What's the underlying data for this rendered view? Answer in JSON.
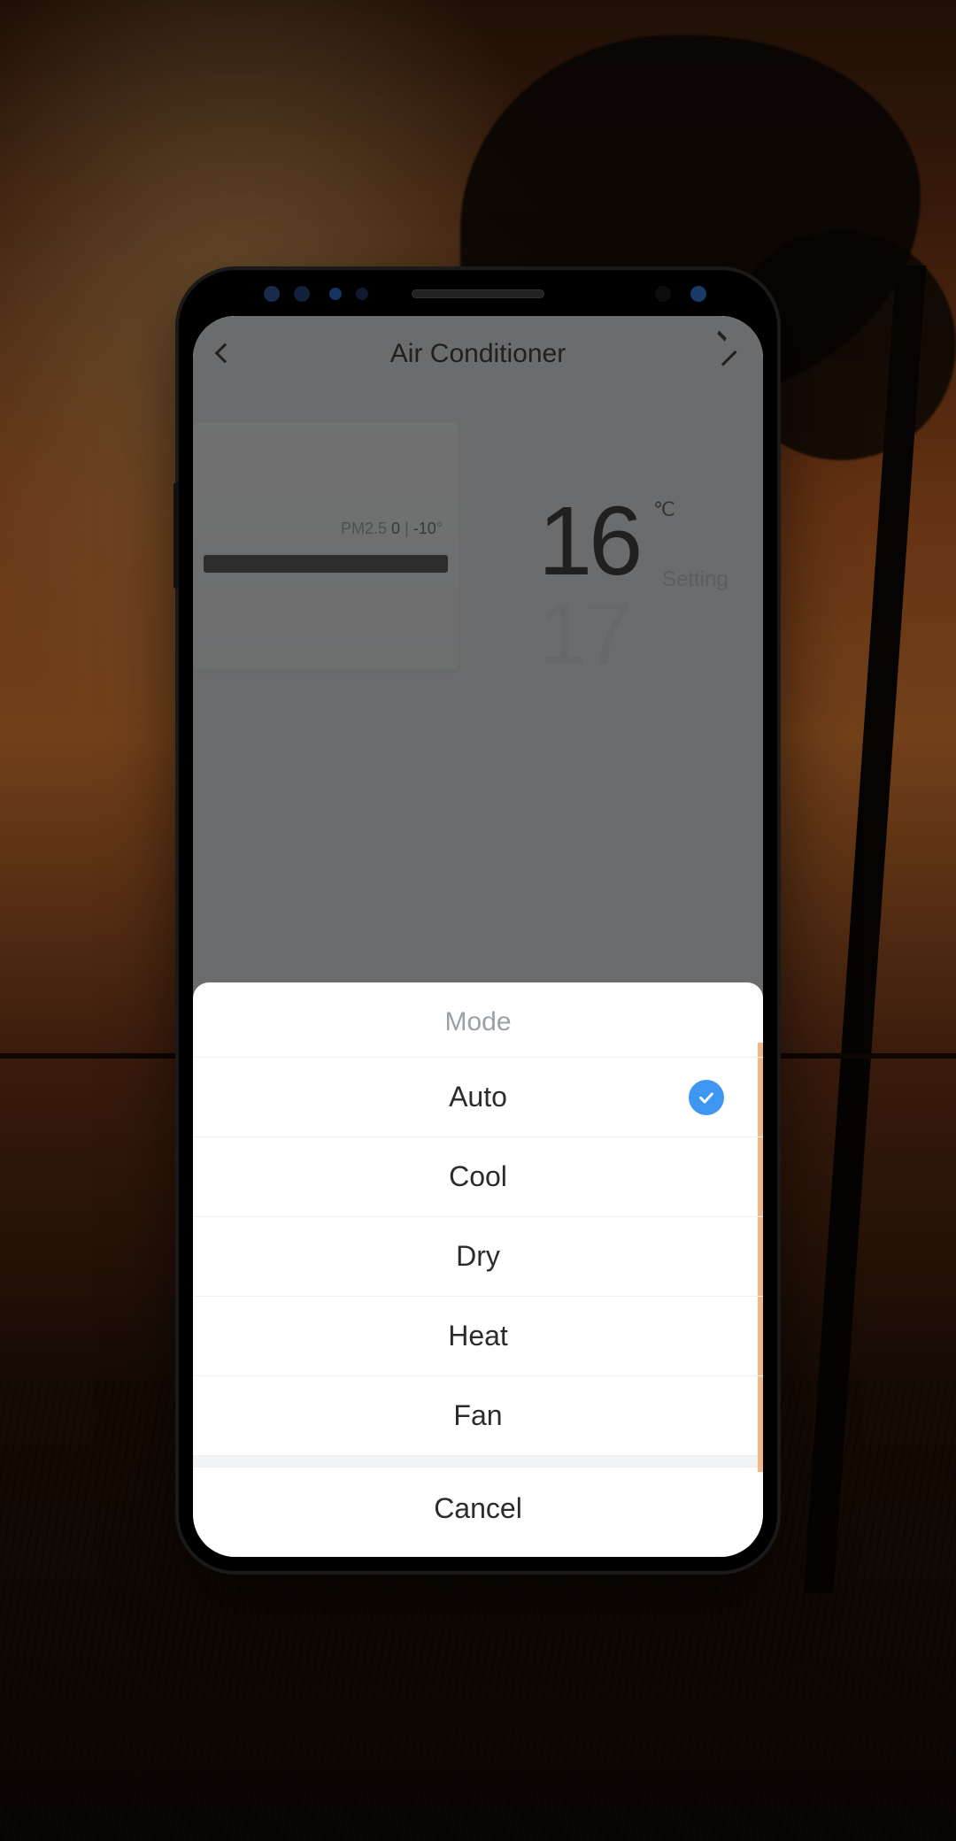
{
  "header": {
    "title": "Air Conditioner"
  },
  "hero": {
    "readout_label": "PM2.5",
    "readout_left": "0",
    "readout_sep": "|",
    "readout_right": "-10",
    "readout_right_unit": "°"
  },
  "temperature": {
    "current": "16",
    "unit": "℃",
    "label": "Setting",
    "next": "17"
  },
  "modeSheet": {
    "title": "Mode",
    "options": [
      {
        "label": "Auto",
        "selected": true
      },
      {
        "label": "Cool",
        "selected": false
      },
      {
        "label": "Dry",
        "selected": false
      },
      {
        "label": "Heat",
        "selected": false
      },
      {
        "label": "Fan",
        "selected": false
      }
    ],
    "cancel": "Cancel"
  },
  "colors": {
    "accent": "#3d97f2",
    "sideAccent": "#f3b58a"
  }
}
